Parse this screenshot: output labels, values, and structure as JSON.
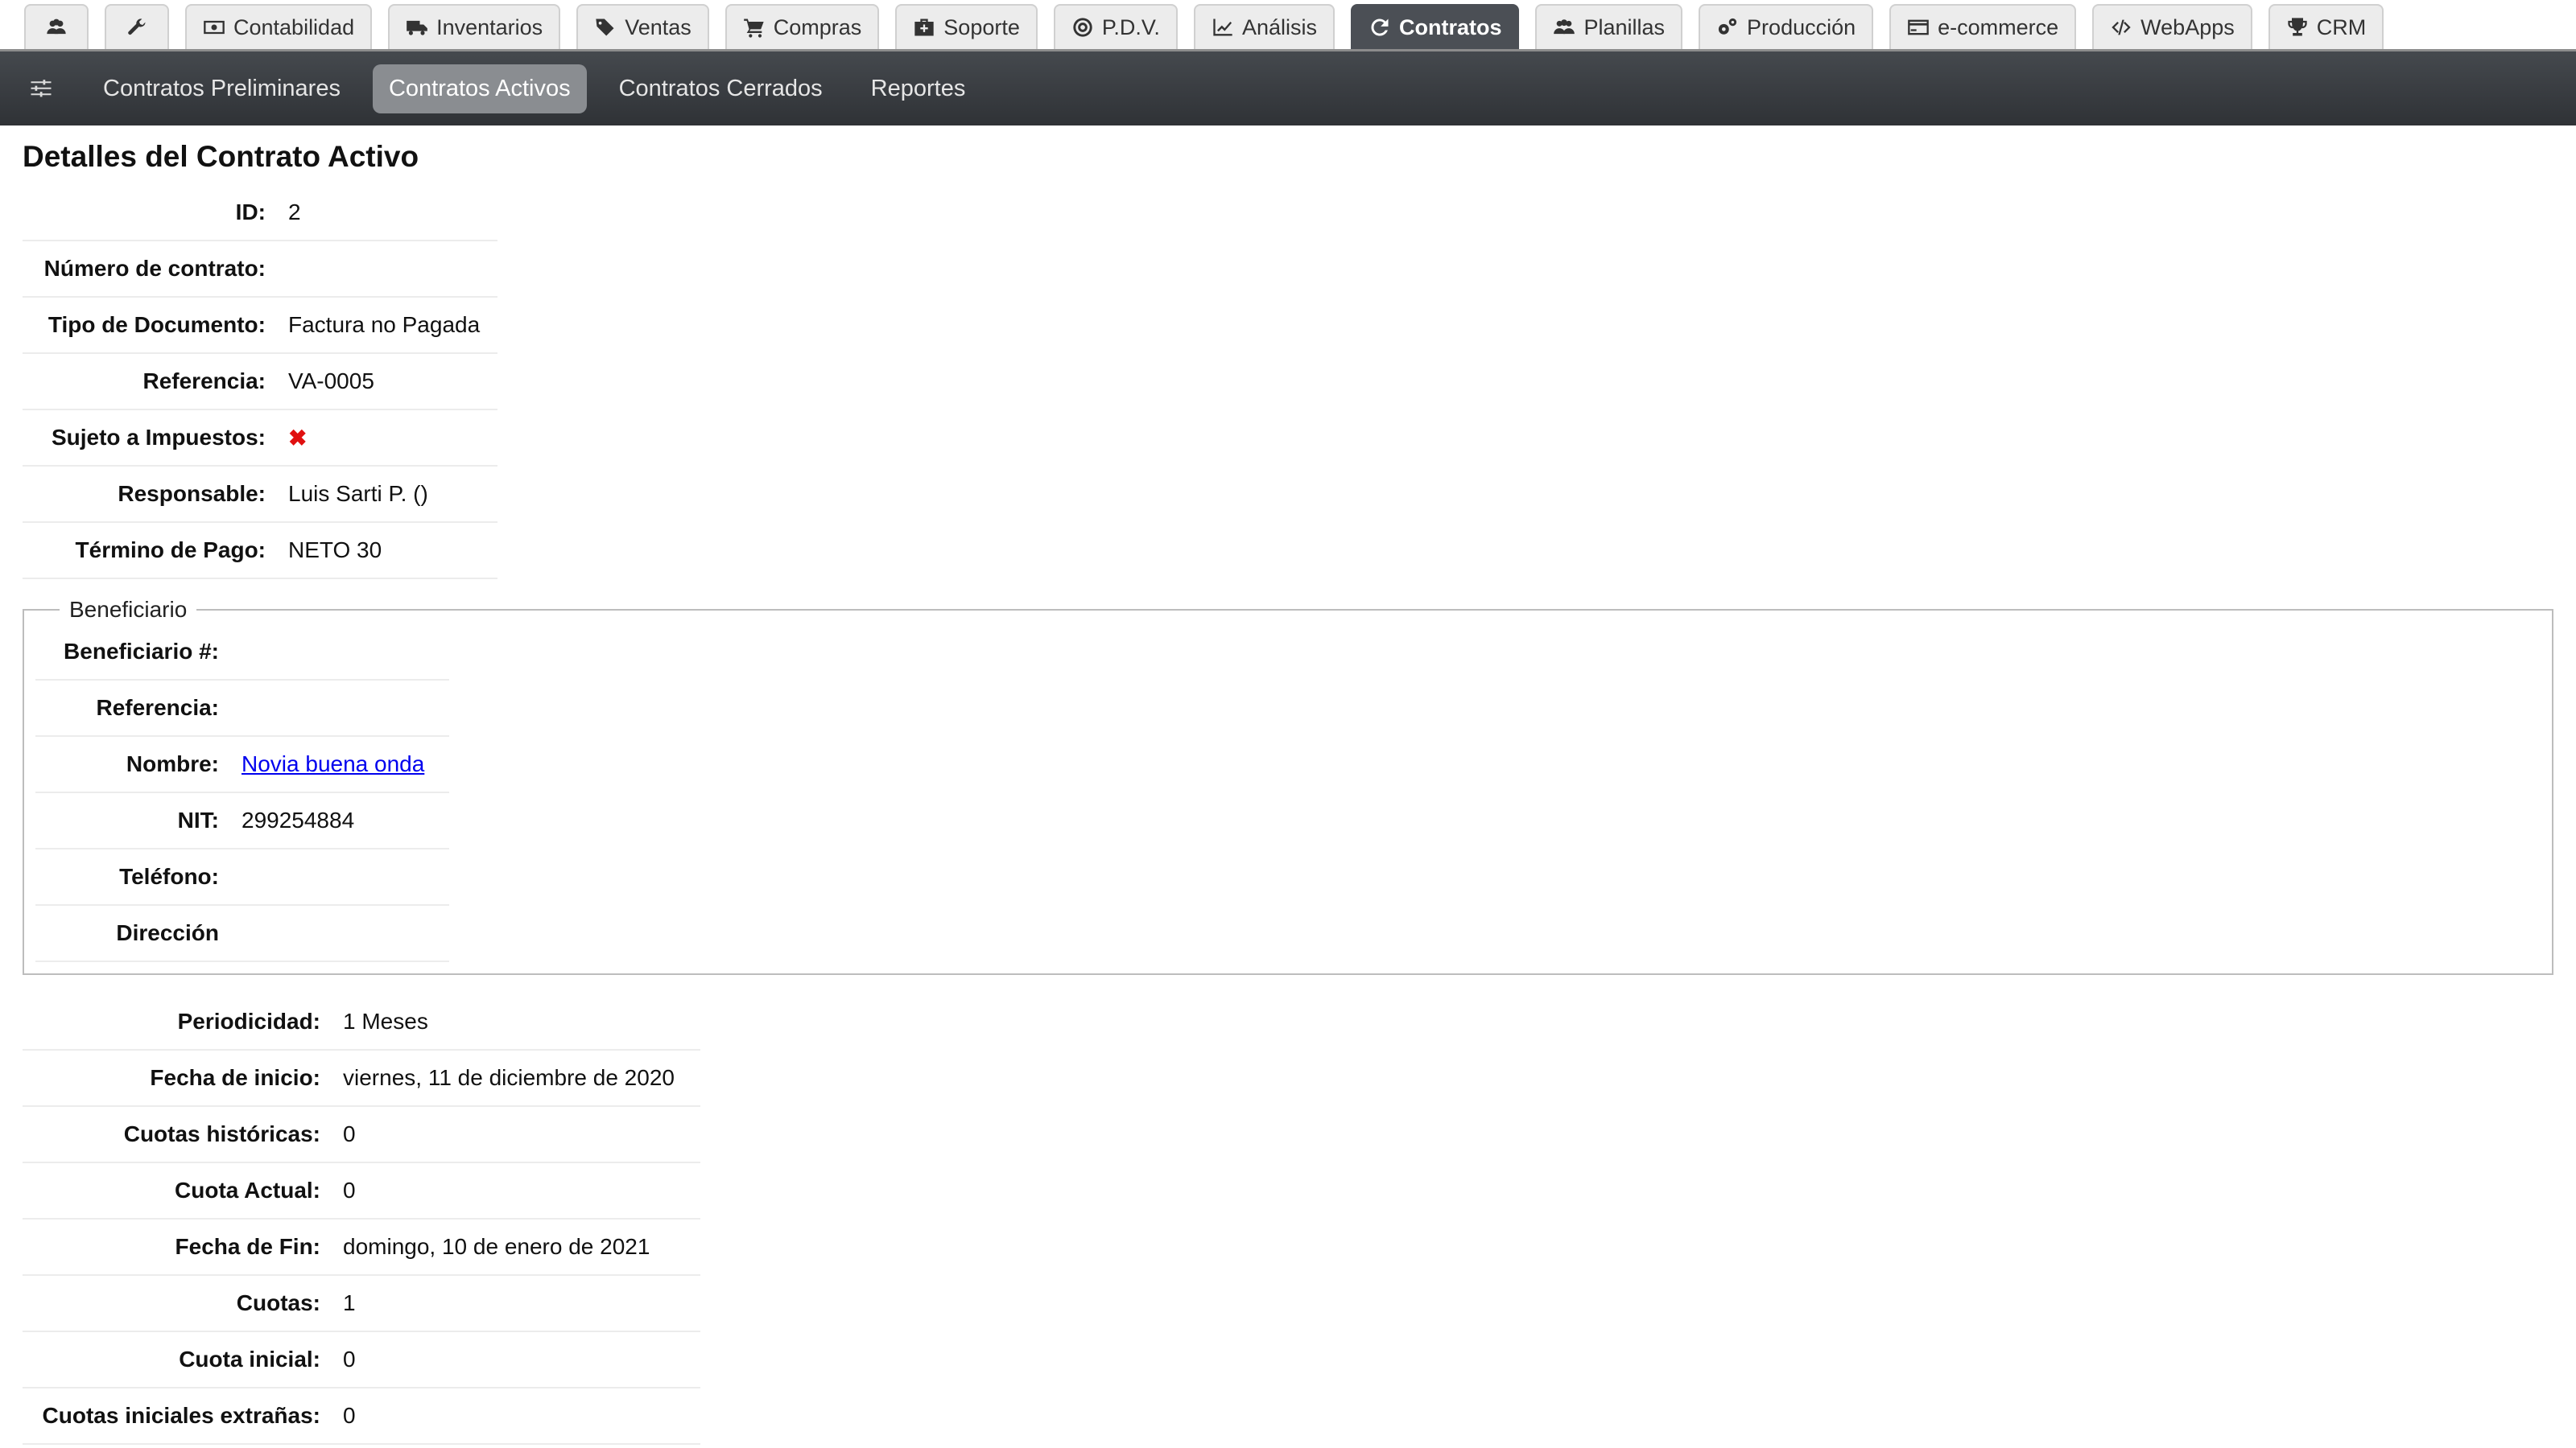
{
  "top_tabs": [
    {
      "label": "",
      "icon": "users-icon"
    },
    {
      "label": "",
      "icon": "wrench-icon"
    },
    {
      "label": "Contabilidad",
      "icon": "money-icon"
    },
    {
      "label": "Inventarios",
      "icon": "truck-icon"
    },
    {
      "label": "Ventas",
      "icon": "tags-icon"
    },
    {
      "label": "Compras",
      "icon": "cart-icon"
    },
    {
      "label": "Soporte",
      "icon": "medkit-icon"
    },
    {
      "label": "P.D.V.",
      "icon": "bullseye-icon"
    },
    {
      "label": "Análisis",
      "icon": "line-chart-icon"
    },
    {
      "label": "Contratos",
      "icon": "refresh-icon",
      "active": true
    },
    {
      "label": "Planillas",
      "icon": "users-icon"
    },
    {
      "label": "Producción",
      "icon": "cogs-icon"
    },
    {
      "label": "e-commerce",
      "icon": "credit-card-icon"
    },
    {
      "label": "WebApps",
      "icon": "code-icon"
    },
    {
      "label": "CRM",
      "icon": "trophy-icon"
    }
  ],
  "subnav": {
    "filter_icon": "sliders-icon",
    "items": [
      "Contratos Preliminares",
      "Contratos Activos",
      "Contratos Cerrados",
      "Reportes"
    ],
    "active_index": 1
  },
  "page_title": "Detalles del Contrato Activo",
  "details": [
    {
      "label": "ID:",
      "value": "2"
    },
    {
      "label": "Número de contrato:",
      "value": ""
    },
    {
      "label": "Tipo de Documento:",
      "value": "Factura no Pagada"
    },
    {
      "label": "Referencia:",
      "value": "VA-0005"
    },
    {
      "label": "Sujeto a Impuestos:",
      "value": "✖",
      "icon": "x-mark-icon",
      "color": "#e01010"
    },
    {
      "label": "Responsable:",
      "value": "Luis Sarti P. ()"
    },
    {
      "label": "Término de Pago:",
      "value": "NETO 30"
    }
  ],
  "beneficiario": {
    "legend": "Beneficiario",
    "rows": [
      {
        "label": "Beneficiario #:",
        "value": ""
      },
      {
        "label": "Referencia:",
        "value": ""
      },
      {
        "label": "Nombre:",
        "value": "Novia buena onda",
        "link": true
      },
      {
        "label": "NIT:",
        "value": "299254884"
      },
      {
        "label": "Teléfono:",
        "value": ""
      },
      {
        "label": "Dirección",
        "value": ""
      }
    ]
  },
  "schedule": [
    {
      "label": "Periodicidad:",
      "value": "1 Meses"
    },
    {
      "label": "Fecha de inicio:",
      "value": "viernes, 11 de diciembre de 2020"
    },
    {
      "label": "Cuotas históricas:",
      "value": "0"
    },
    {
      "label": "Cuota Actual:",
      "value": "0"
    },
    {
      "label": "Fecha de Fin:",
      "value": "domingo, 10 de enero de 2021"
    },
    {
      "label": "Cuotas:",
      "value": "1"
    },
    {
      "label": "Cuota inicial:",
      "value": "0"
    },
    {
      "label": "Cuotas iniciales extrañas:",
      "value": "0"
    }
  ]
}
